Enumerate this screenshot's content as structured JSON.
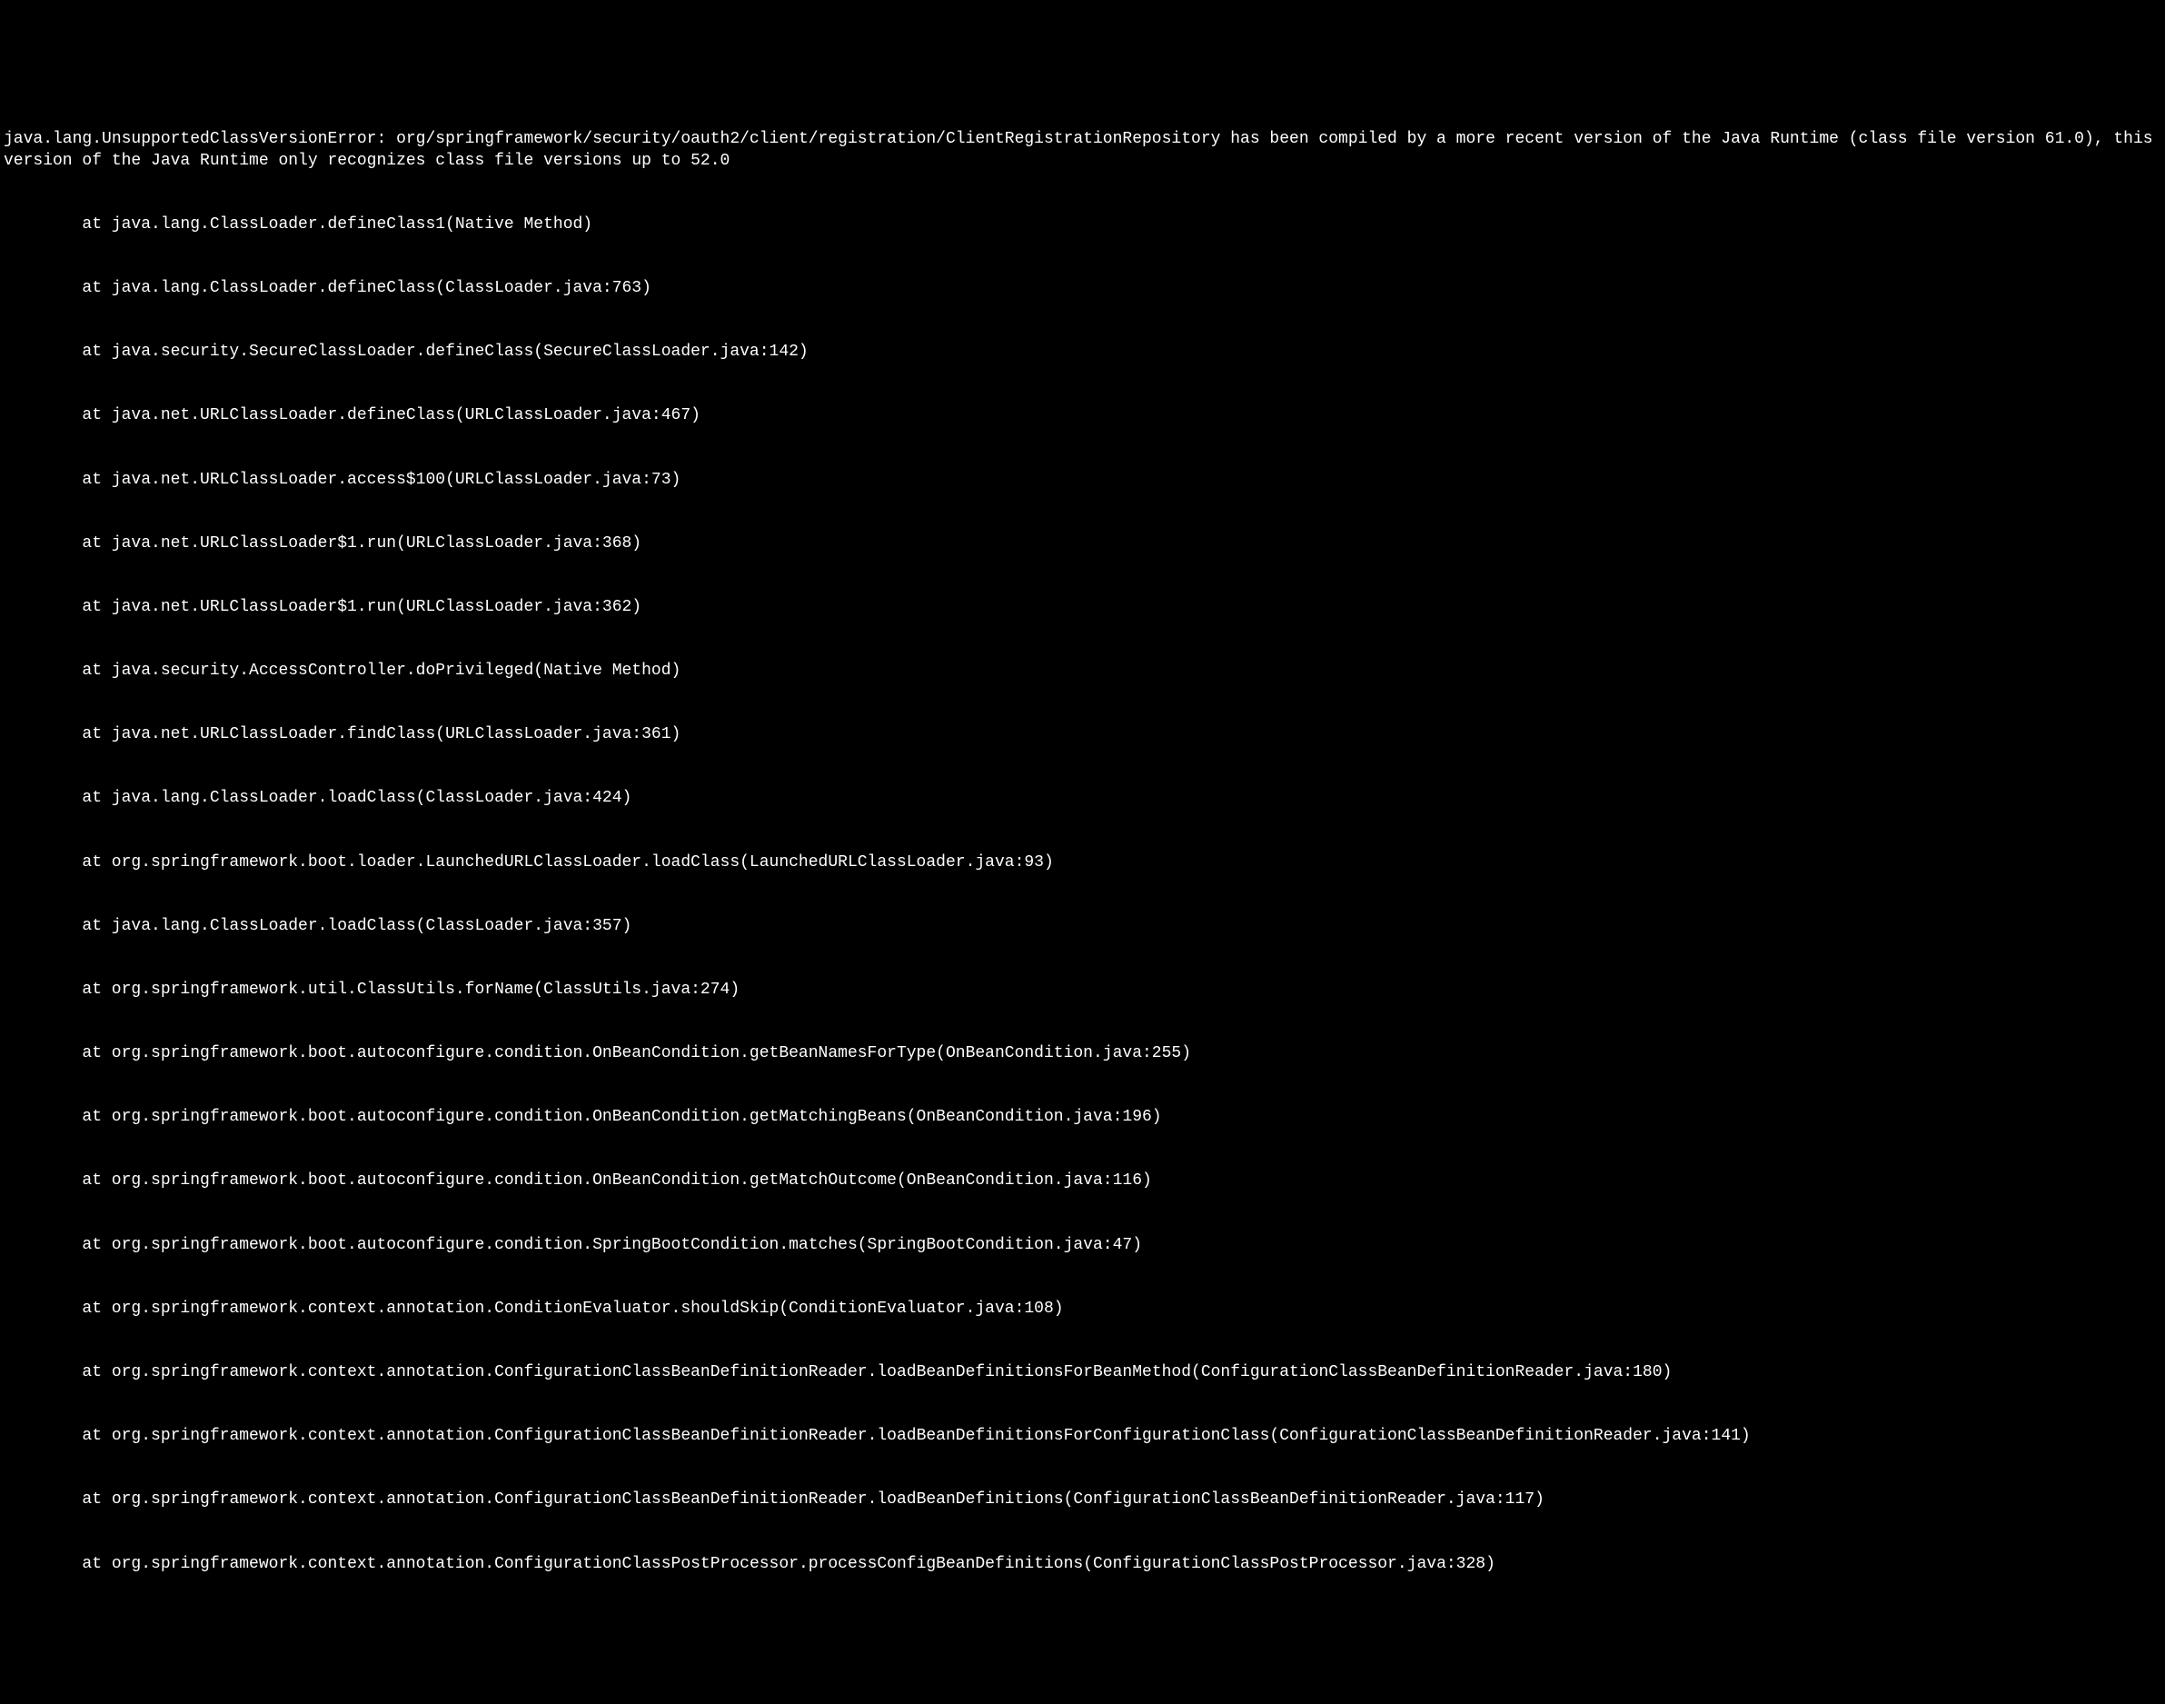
{
  "terminal": {
    "error_header": "java.lang.UnsupportedClassVersionError: org/springframework/security/oauth2/client/registration/ClientRegistrationRepository has been compiled by a more recent version of the Java Runtime (class file version 61.0), this version of the Java Runtime only recognizes class file versions up to 52.0",
    "stack_frames": [
      "at java.lang.ClassLoader.defineClass1(Native Method)",
      "at java.lang.ClassLoader.defineClass(ClassLoader.java:763)",
      "at java.security.SecureClassLoader.defineClass(SecureClassLoader.java:142)",
      "at java.net.URLClassLoader.defineClass(URLClassLoader.java:467)",
      "at java.net.URLClassLoader.access$100(URLClassLoader.java:73)",
      "at java.net.URLClassLoader$1.run(URLClassLoader.java:368)",
      "at java.net.URLClassLoader$1.run(URLClassLoader.java:362)",
      "at java.security.AccessController.doPrivileged(Native Method)",
      "at java.net.URLClassLoader.findClass(URLClassLoader.java:361)",
      "at java.lang.ClassLoader.loadClass(ClassLoader.java:424)",
      "at org.springframework.boot.loader.LaunchedURLClassLoader.loadClass(LaunchedURLClassLoader.java:93)",
      "at java.lang.ClassLoader.loadClass(ClassLoader.java:357)",
      "at org.springframework.util.ClassUtils.forName(ClassUtils.java:274)",
      "at org.springframework.boot.autoconfigure.condition.OnBeanCondition.getBeanNamesForType(OnBeanCondition.java:255)",
      "at org.springframework.boot.autoconfigure.condition.OnBeanCondition.getMatchingBeans(OnBeanCondition.java:196)",
      "at org.springframework.boot.autoconfigure.condition.OnBeanCondition.getMatchOutcome(OnBeanCondition.java:116)",
      "at org.springframework.boot.autoconfigure.condition.SpringBootCondition.matches(SpringBootCondition.java:47)",
      "at org.springframework.context.annotation.ConditionEvaluator.shouldSkip(ConditionEvaluator.java:108)"
    ],
    "wrapped_frames": [
      {
        "prefix": "        at ",
        "text": "org.springframework.context.annotation.ConfigurationClassBeanDefinitionReader.loadBeanDefinitionsForBeanMethod(ConfigurationClassBeanDefinitionReader.java:180)"
      },
      {
        "prefix": "        at ",
        "text": "org.springframework.context.annotation.ConfigurationClassBeanDefinitionReader.loadBeanDefinitionsForConfigurationClass(ConfigurationClassBeanDefinitionReader.java:141)"
      },
      {
        "prefix": "        at ",
        "text": "org.springframework.context.annotation.ConfigurationClassBeanDefinitionReader.loadBeanDefinitions(ConfigurationClassBeanDefinitionReader.java:117)"
      },
      {
        "prefix": "        at ",
        "text": "org.springframework.context.annotation.ConfigurationClassPostProcessor.processConfigBeanDefinitions(ConfigurationClassPostProcessor.java:328)"
      }
    ]
  }
}
